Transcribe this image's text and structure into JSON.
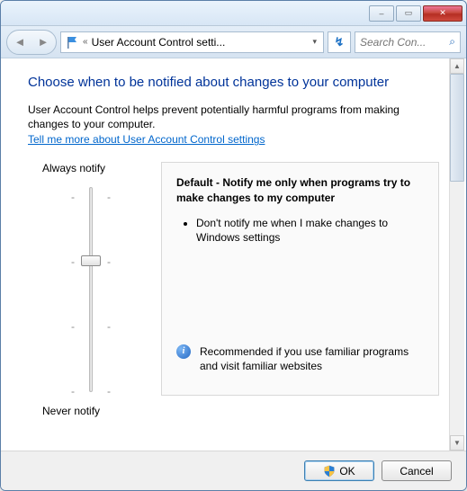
{
  "titlebar": {
    "minimize_glyph": "–",
    "maximize_glyph": "▭",
    "close_glyph": "✕"
  },
  "toolbar": {
    "back_glyph": "◄",
    "forward_glyph": "►",
    "breadcrumb_chevron": "«",
    "breadcrumb_text": "User Account Control setti...",
    "dropdown_glyph": "▾",
    "refresh_glyph": "↻",
    "search_placeholder": "Search Con...",
    "search_glyph": "🔍"
  },
  "page": {
    "heading": "Choose when to be notified about changes to your computer",
    "intro": "User Account Control helps prevent potentially harmful programs from making changes to your computer.",
    "help_link": "Tell me more about User Account Control settings"
  },
  "slider": {
    "top_label": "Always notify",
    "bottom_label": "Never notify",
    "levels": 4,
    "current_level": 1
  },
  "description": {
    "title": "Default - Notify me only when programs try to make changes to my computer",
    "bullet1": "Don't notify me when I make changes to Windows settings",
    "recommendation": "Recommended if you use familiar programs and visit familiar websites"
  },
  "buttons": {
    "ok": "OK",
    "cancel": "Cancel"
  }
}
